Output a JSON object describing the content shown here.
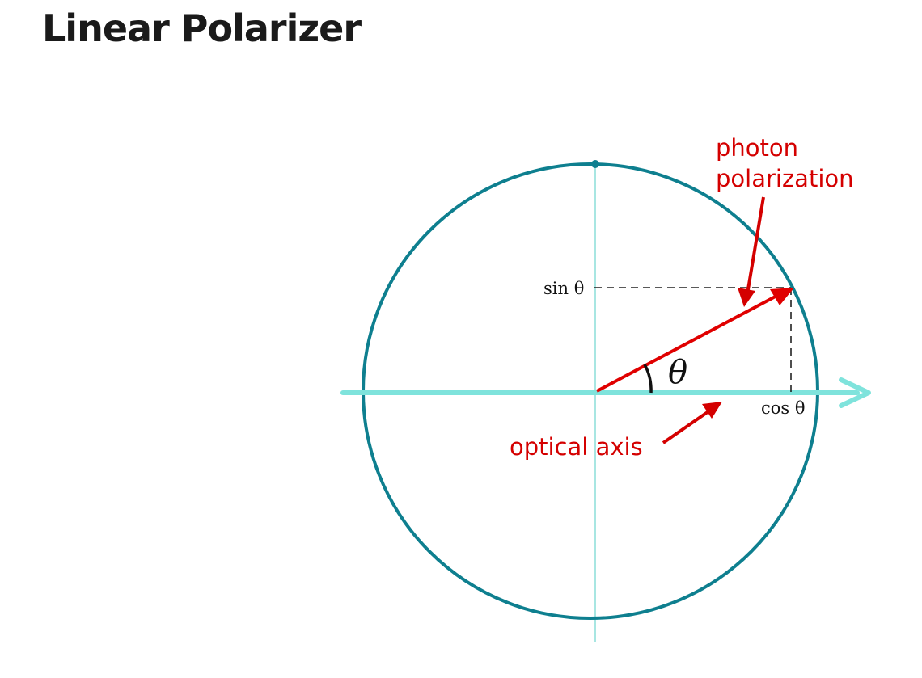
{
  "slide": {
    "title": "Linear Polarizer"
  },
  "diagram": {
    "angle_label": "θ",
    "sin_label": "sin θ",
    "cos_label": "cos θ",
    "photon_label_line1": "photon",
    "photon_label_line2": "polarization",
    "axis_label": "optical axis",
    "colors": {
      "circle": "#0e7f8f",
      "axis": "#7fe3dc",
      "vertical_axis": "#a8e6e2",
      "annotation": "#d40000",
      "dashed": "#222222"
    }
  }
}
